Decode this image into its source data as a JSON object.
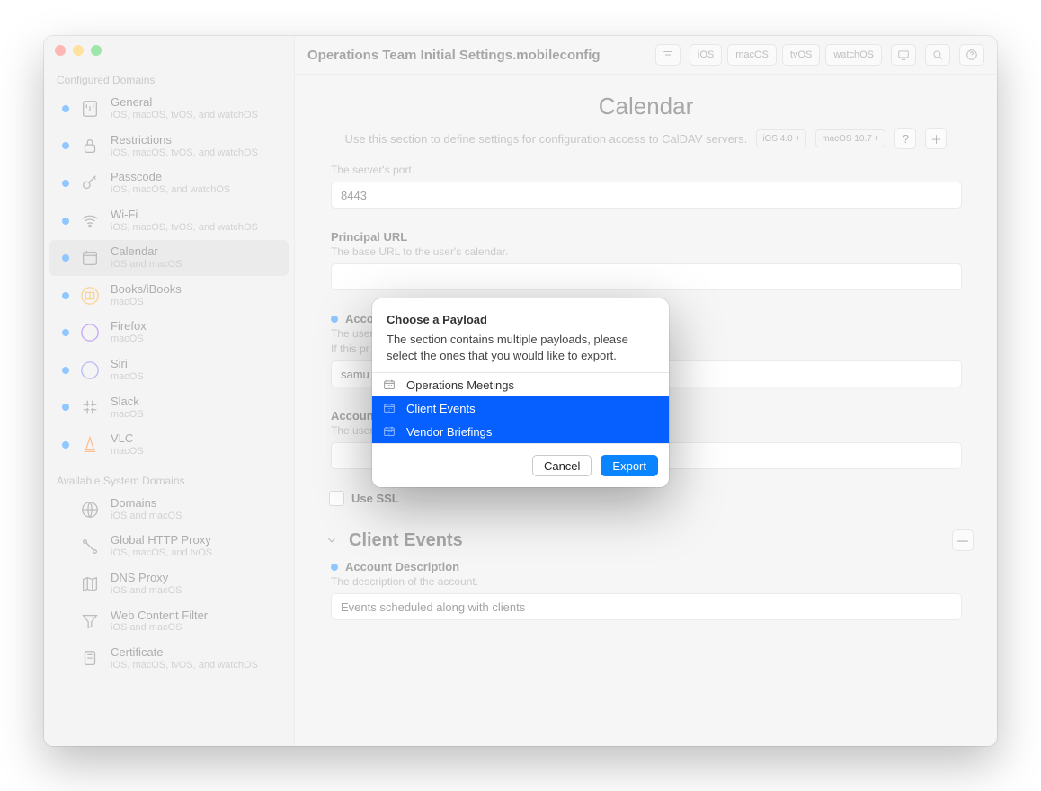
{
  "window_title": "Operations Team Initial Settings.mobileconfig",
  "platform_tags": [
    "iOS",
    "macOS",
    "tvOS",
    "watchOS"
  ],
  "sidebar": {
    "configured_header": "Configured Domains",
    "available_header": "Available System Domains",
    "configured": [
      {
        "title": "General",
        "sub": "iOS, macOS, tvOS, and watchOS",
        "dot": true,
        "icon": "sliders"
      },
      {
        "title": "Restrictions",
        "sub": "iOS, macOS, tvOS, and watchOS",
        "dot": true,
        "icon": "lock"
      },
      {
        "title": "Passcode",
        "sub": "iOS, macOS, and watchOS",
        "dot": true,
        "icon": "key"
      },
      {
        "title": "Wi-Fi",
        "sub": "iOS, macOS, tvOS, and watchOS",
        "dot": true,
        "icon": "wifi"
      },
      {
        "title": "Calendar",
        "sub": "iOS and macOS",
        "dot": true,
        "icon": "calendar",
        "selected": true
      },
      {
        "title": "Books/iBooks",
        "sub": "macOS",
        "dot": true,
        "icon": "books",
        "color": "#f59e0b"
      },
      {
        "title": "Firefox",
        "sub": "macOS",
        "dot": true,
        "icon": "circle",
        "color": "#7c3aed"
      },
      {
        "title": "Siri",
        "sub": "macOS",
        "dot": true,
        "icon": "circle",
        "color": "#6366f1"
      },
      {
        "title": "Slack",
        "sub": "macOS",
        "dot": true,
        "icon": "slack"
      },
      {
        "title": "VLC",
        "sub": "macOS",
        "dot": true,
        "icon": "cone",
        "color": "#f97316"
      }
    ],
    "available": [
      {
        "title": "Domains",
        "sub": "iOS and macOS",
        "icon": "globe"
      },
      {
        "title": "Global HTTP Proxy",
        "sub": "iOS, macOS, and tvOS",
        "icon": "proxy"
      },
      {
        "title": "DNS Proxy",
        "sub": "iOS and macOS",
        "icon": "map"
      },
      {
        "title": "Web Content Filter",
        "sub": "iOS and macOS",
        "icon": "funnel"
      },
      {
        "title": "Certificate",
        "sub": "iOS, macOS, tvOS, and watchOS",
        "icon": "cert"
      }
    ]
  },
  "page": {
    "title": "Calendar",
    "desc": "Use this section to define settings for configuration access to CalDAV servers.",
    "pills": [
      "iOS  4.0 +",
      "macOS  10.7 +"
    ],
    "port_hint": "The server's port.",
    "port_value": "8443",
    "principal": {
      "label": "Principal URL",
      "hint": "The base URL to the user's calendar."
    },
    "acc_user": {
      "label": "Accoun",
      "hint": "The user",
      "hint2": "If this pr",
      "value": "samu"
    },
    "acc_pass": {
      "label": "Accoun",
      "hint": "The user"
    },
    "use_ssl": "Use SSL",
    "section2": {
      "title": "Client Events"
    },
    "acc_desc": {
      "label": "Account Description",
      "hint": "The description of the account.",
      "value": "Events scheduled along with clients"
    }
  },
  "modal": {
    "title": "Choose a Payload",
    "desc": "The section contains multiple payloads, please select the ones that you would like to export.",
    "items": [
      {
        "label": "Operations Meetings",
        "selected": false
      },
      {
        "label": "Client Events",
        "selected": true
      },
      {
        "label": "Vendor Briefings",
        "selected": true
      }
    ],
    "cancel": "Cancel",
    "export": "Export"
  }
}
